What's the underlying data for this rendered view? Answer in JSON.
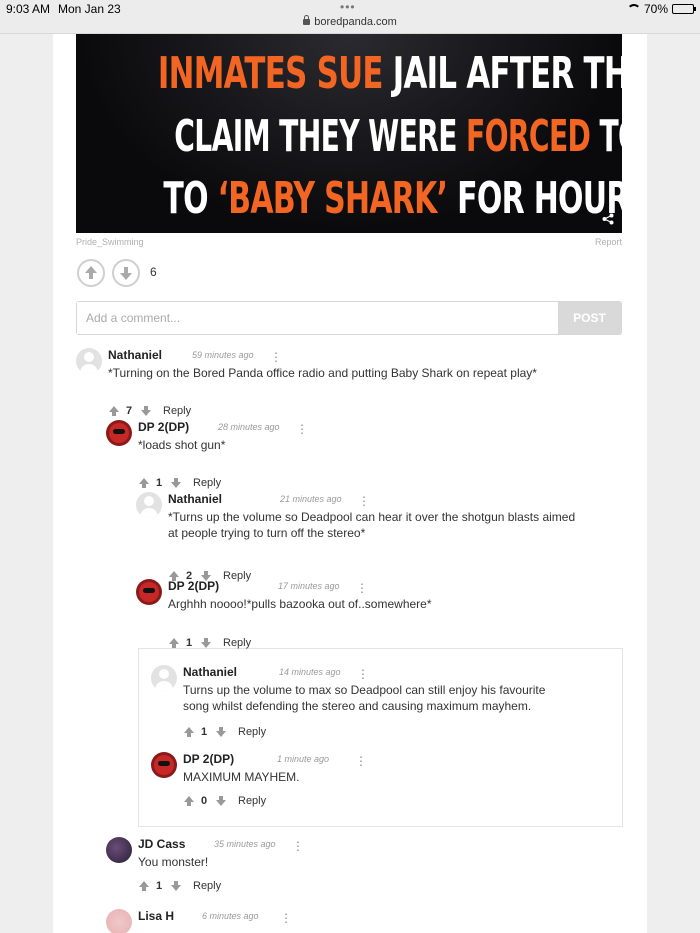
{
  "status_bar": {
    "time": "9:03 AM",
    "date": "Mon Jan 23",
    "dots": "•••",
    "url": "boredpanda.com",
    "battery": "70%",
    "battery_level": 0.7
  },
  "article": {
    "headline_words": [
      [
        {
          "t": "INMATES SUE",
          "c": "o"
        },
        {
          "t": " JAIL AFTER THEY",
          "c": "w"
        }
      ],
      [
        {
          "t": "CLAIM THEY WERE ",
          "c": "w"
        },
        {
          "t": "FORCED",
          "c": "o"
        },
        {
          "t": " TO LISTEN",
          "c": "w"
        }
      ],
      [
        {
          "t": "TO ",
          "c": "w"
        },
        {
          "t": "‘BABY SHARK’",
          "c": "o"
        },
        {
          "t": " FOR HOURS",
          "c": "w"
        }
      ]
    ],
    "credit": "Pride_Swimming",
    "report": "Report",
    "vote_count": "6"
  },
  "comment_form": {
    "placeholder": "Add a comment...",
    "post_label": "POST"
  },
  "comments": [
    {
      "name": "Nathaniel",
      "time": "59 minutes ago",
      "text": "*Turning on the Bored Panda office radio and putting Baby Shark on repeat play*",
      "votes": "7",
      "reply": "Reply",
      "avatar": "default"
    },
    {
      "name": "DP 2(DP)",
      "time": "28 minutes ago",
      "text": "*loads shot gun*",
      "votes": "1",
      "reply": "Reply",
      "avatar": "dp"
    },
    {
      "name": "Nathaniel",
      "time": "21 minutes ago",
      "text": "*Turns up the volume so Deadpool can hear it over the shotgun blasts aimed at people trying to turn off the stereo*",
      "votes": "2",
      "reply": "Reply",
      "avatar": "default"
    },
    {
      "name": "DP 2(DP)",
      "time": "17 minutes ago",
      "text": "Arghhh noooo!*pulls bazooka out of..somewhere*",
      "votes": "1",
      "reply": "Reply",
      "avatar": "dp"
    },
    {
      "name": "Nathaniel",
      "time": "14 minutes ago",
      "text": "Turns up the volume to max so Deadpool can still enjoy his favourite song whilst defending the stereo and causing maximum mayhem.",
      "votes": "1",
      "reply": "Reply",
      "avatar": "default"
    },
    {
      "name": "DP 2(DP)",
      "time": "1 minute ago",
      "text": "MAXIMUM MAYHEM.",
      "votes": "0",
      "reply": "Reply",
      "avatar": "dp"
    },
    {
      "name": "JD Cass",
      "time": "35 minutes ago",
      "text": "You monster!",
      "votes": "1",
      "reply": "Reply",
      "avatar": "jd"
    },
    {
      "name": "Lisa H",
      "time": "6 minutes ago",
      "text": "",
      "votes": "",
      "reply": "",
      "avatar": "lisa"
    }
  ],
  "colors": {
    "accent_orange": "#f26522",
    "hero_background": "#0a0a0c",
    "post_button": "#d9d9d9"
  }
}
